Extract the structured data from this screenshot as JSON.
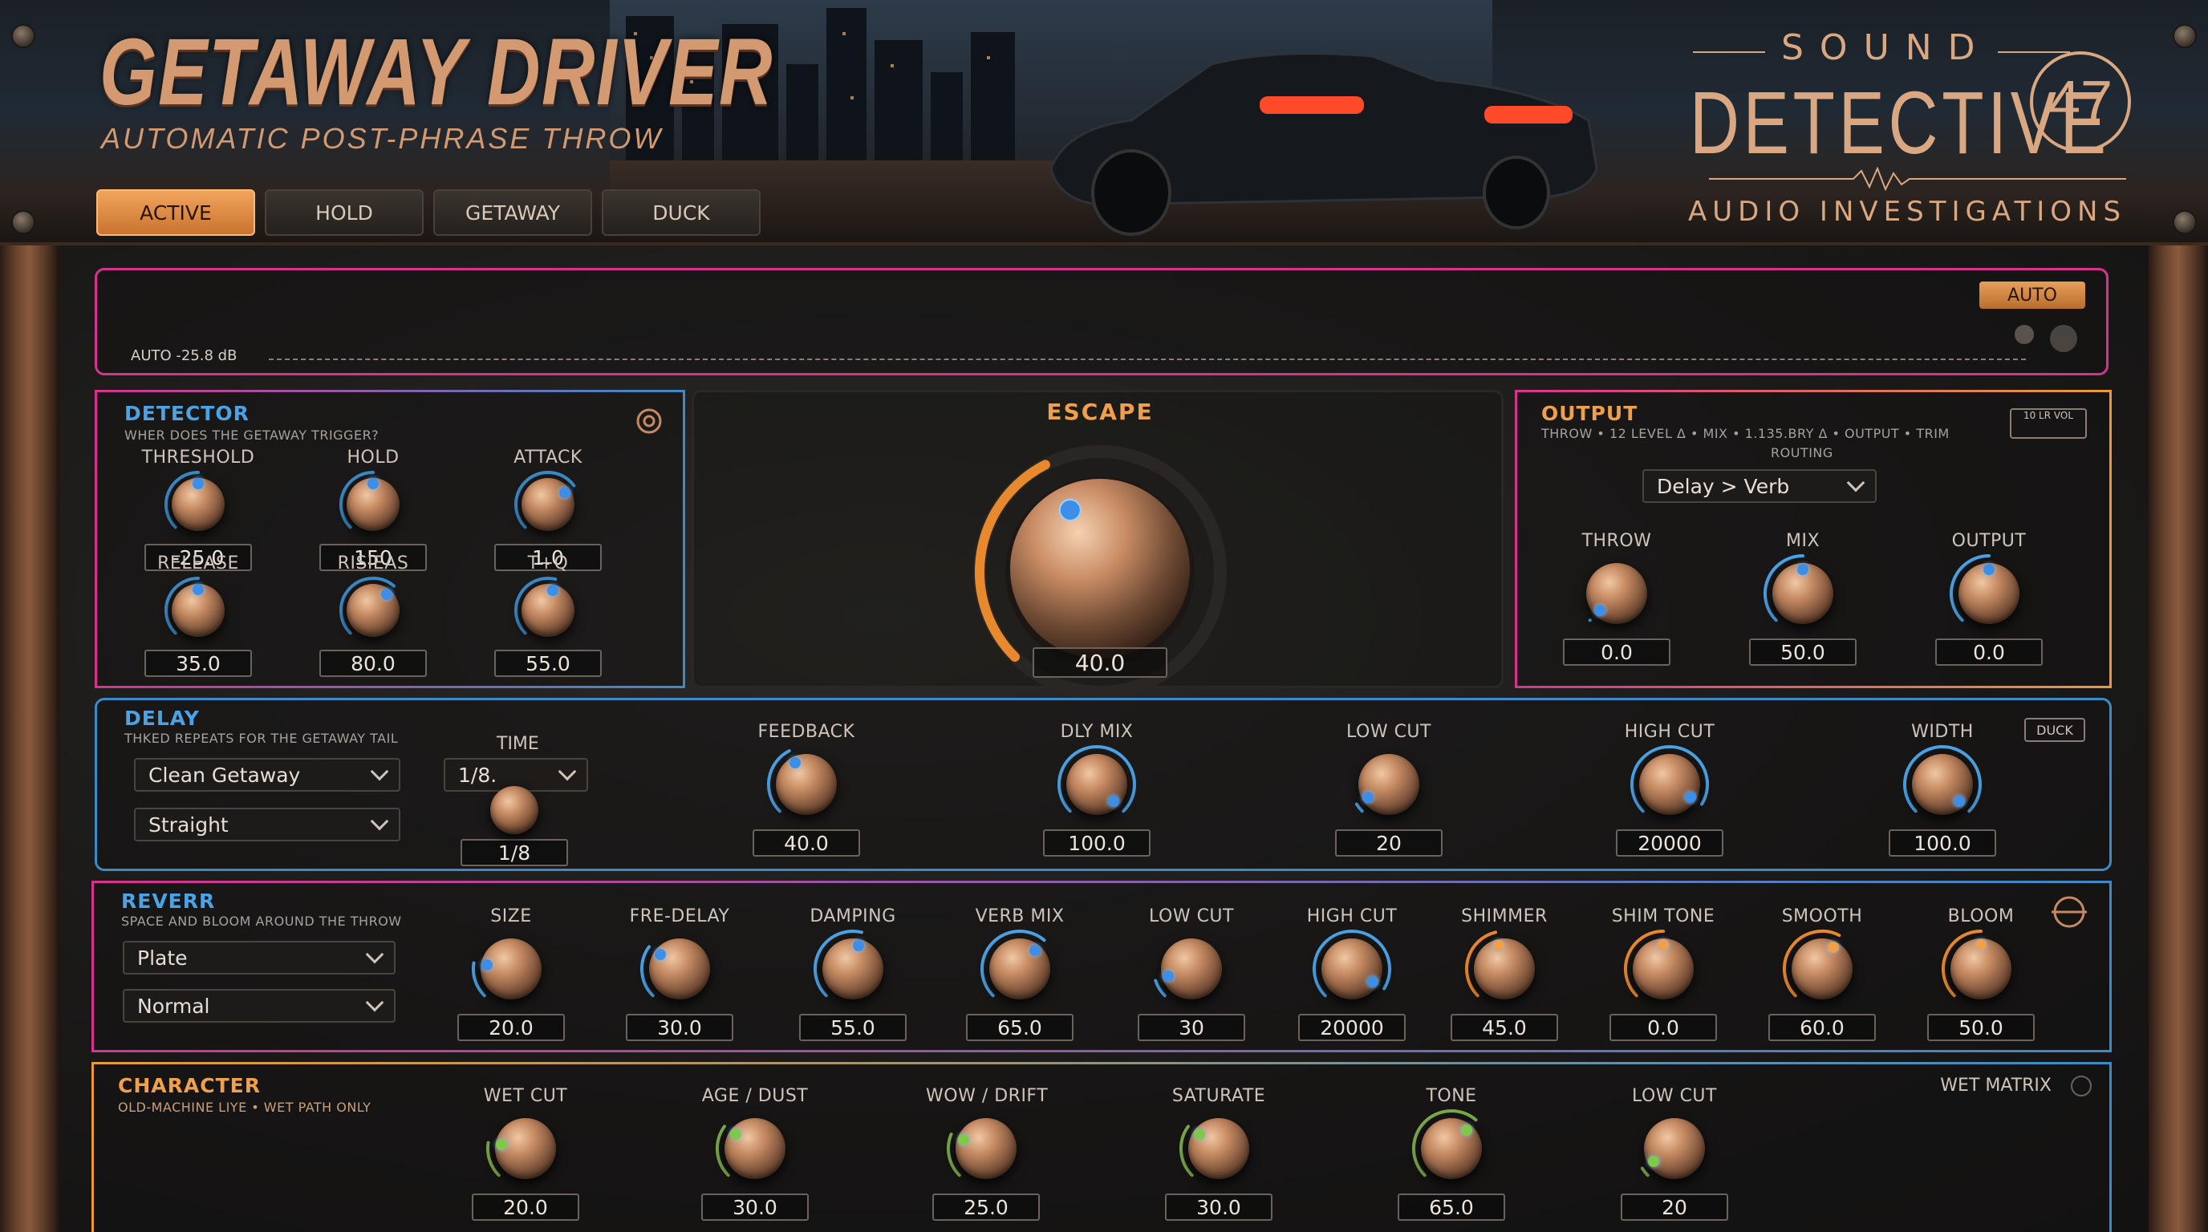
{
  "header": {
    "title": "GETAWAY DRIVER",
    "subtitle": "AUTOMATIC POST-PHRASE THROW",
    "tabs": [
      {
        "label": "ACTIVE",
        "active": true
      },
      {
        "label": "HOLD"
      },
      {
        "label": "GETAWAY"
      },
      {
        "label": "DUCK"
      }
    ],
    "brand": {
      "sound": "SOUND",
      "detective": "DETECTIVE",
      "number": "47",
      "tagline": "AUDIO INVESTIGATIONS"
    }
  },
  "meter": {
    "auto_label": "AUTO -25.8 dB",
    "auto_button": "AUTO"
  },
  "detector": {
    "title": "DETECTOR",
    "subtitle": "WHER DOES THE GETAWAY TRIGGER?",
    "knobs": [
      {
        "label": "THRESHOLD",
        "value": "-25.0",
        "level": 0.5
      },
      {
        "label": "HOLD",
        "value": "150",
        "level": 0.5
      },
      {
        "label": "ATTACK",
        "value": "1.0",
        "level": 0.7
      },
      {
        "label": "RELEASE",
        "value": "35.0",
        "level": 0.5
      },
      {
        "label": "RISIEAS",
        "value": "80.0",
        "level": 0.65
      },
      {
        "label": "T+Q",
        "value": "55.0",
        "level": 0.55
      }
    ]
  },
  "escape": {
    "label": "ESCAPE",
    "value": "40.0",
    "level": 0.4
  },
  "output": {
    "title": "OUTPUT",
    "subtitle": "THROW  •  12 LEVEL Δ • MIX  •  1.135.BRY Δ • OUTPUT • TRIM",
    "routing_label": "ROUTING",
    "routing": "Delay  >  Verb",
    "level_badge": "10 LR VOL",
    "knobs": [
      {
        "label": "THROW",
        "value": "0.0",
        "level": 0.0
      },
      {
        "label": "MIX",
        "value": "50.0",
        "level": 0.5
      },
      {
        "label": "OUTPUT",
        "value": "0.0",
        "level": 0.5
      }
    ]
  },
  "delay": {
    "title": "DELAY",
    "subtitle": "THKED REPEATS FOR THE GETAWAY TAIL",
    "mode": "Clean Getaway",
    "feel": "Straight",
    "time_label": "TIME",
    "time_select": "1/8.",
    "time_value": "1/8",
    "duck_badge": "DUCK",
    "knobs": [
      {
        "label": "FEEDBACK",
        "value": "40.0",
        "level": 0.4
      },
      {
        "label": "DLY MIX",
        "value": "100.0",
        "level": 1.0
      },
      {
        "label": "LOW CUT",
        "value": "20",
        "level": 0.05
      },
      {
        "label": "HIGH CUT",
        "value": "20000",
        "level": 0.95
      },
      {
        "label": "WIDTH",
        "value": "100.0",
        "level": 1.0
      }
    ]
  },
  "reverb": {
    "title": "REVERR",
    "subtitle": "SPACE AND BLOOM AROUND THE THROW",
    "type": "Plate",
    "mode": "Normal",
    "knobs": [
      {
        "label": "SIZE",
        "value": "20.0",
        "level": 0.2
      },
      {
        "label": "FRE-DELAY",
        "value": "30.0",
        "level": 0.3
      },
      {
        "label": "DAMPING",
        "value": "55.0",
        "level": 0.55
      },
      {
        "label": "VERB MIX",
        "value": "65.0",
        "level": 0.65
      },
      {
        "label": "LOW CUT",
        "value": "30",
        "level": 0.1
      },
      {
        "label": "HIGH CUT",
        "value": "20000",
        "level": 0.95
      },
      {
        "label": "SHIMMER",
        "value": "45.0",
        "level": 0.45
      },
      {
        "label": "SHIM TONE",
        "value": "0.0",
        "level": 0.5
      },
      {
        "label": "SMOOTH",
        "value": "60.0",
        "level": 0.6
      },
      {
        "label": "BLOOM",
        "value": "50.0",
        "level": 0.5
      }
    ]
  },
  "character": {
    "title": "CHARACTER",
    "subtitle": "OLD-MACHINE LIYE  •  WET PATH ONLY",
    "matrix": "WET MATRIX",
    "knobs": [
      {
        "label": "WET CUT",
        "value": "20.0",
        "level": 0.2
      },
      {
        "label": "AGE / DUST",
        "value": "30.0",
        "level": 0.3
      },
      {
        "label": "WOW / DRIFT",
        "value": "25.0",
        "level": 0.25
      },
      {
        "label": "SATURATE",
        "value": "30.0",
        "level": 0.3
      },
      {
        "label": "TONE",
        "value": "65.0",
        "level": 0.65
      },
      {
        "label": "LOW CUT",
        "value": "20",
        "level": 0.05
      }
    ]
  },
  "colors": {
    "accent_blue": "#3a8bc8",
    "accent_pink": "#d6338f",
    "accent_orange": "#e89a3a",
    "copper": "#d39a72"
  }
}
